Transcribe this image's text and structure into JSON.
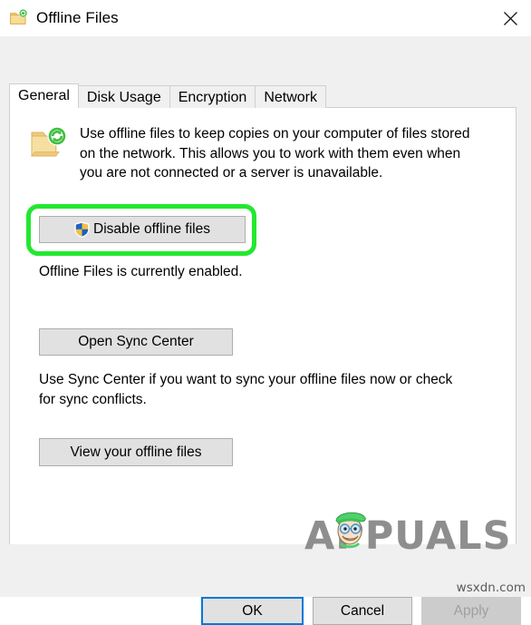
{
  "window": {
    "title": "Offline Files",
    "icon": "offline-files-folder-icon",
    "close_label": "✕"
  },
  "tabs": [
    {
      "label": "General",
      "active": true
    },
    {
      "label": "Disk Usage",
      "active": false
    },
    {
      "label": "Encryption",
      "active": false
    },
    {
      "label": "Network",
      "active": false
    }
  ],
  "general": {
    "intro_icon": "offline-files-folder-icon",
    "intro_text": "Use offline files to keep copies on your computer of files stored\non the network.  This allows you to work with them even when\nyou are not connected or a server is unavailable.",
    "disable_button": {
      "label": "Disable offline files",
      "icon": "uac-shield-icon"
    },
    "status_text": "Offline Files is currently enabled.",
    "open_sync_center_button": "Open Sync Center",
    "sync_description": "Use Sync Center if you want to sync your offline files now or check\nfor sync conflicts.",
    "view_offline_files_button": "View your offline files"
  },
  "footer": {
    "ok": "OK",
    "cancel": "Cancel",
    "apply": "Apply",
    "apply_disabled": true
  },
  "annotation": {
    "type": "green-rounded-highlight",
    "target": "disable-offline-files-button",
    "color": "#22e830"
  },
  "watermarks": {
    "brand": "APPUALS",
    "site": "wsxdn.com"
  },
  "colors": {
    "dialog_background": "#f0f0f0",
    "panel_background": "#ffffff",
    "button_face": "#e1e1e1",
    "button_border": "#adadad",
    "focus_border": "#0078d7",
    "disabled_text": "#a0a0a0",
    "highlight_green": "#22e830",
    "folder_yellow": "#f5d57a",
    "sync_green": "#2eb82e",
    "shield_blue": "#1a5fb4",
    "shield_yellow": "#f0c040"
  }
}
